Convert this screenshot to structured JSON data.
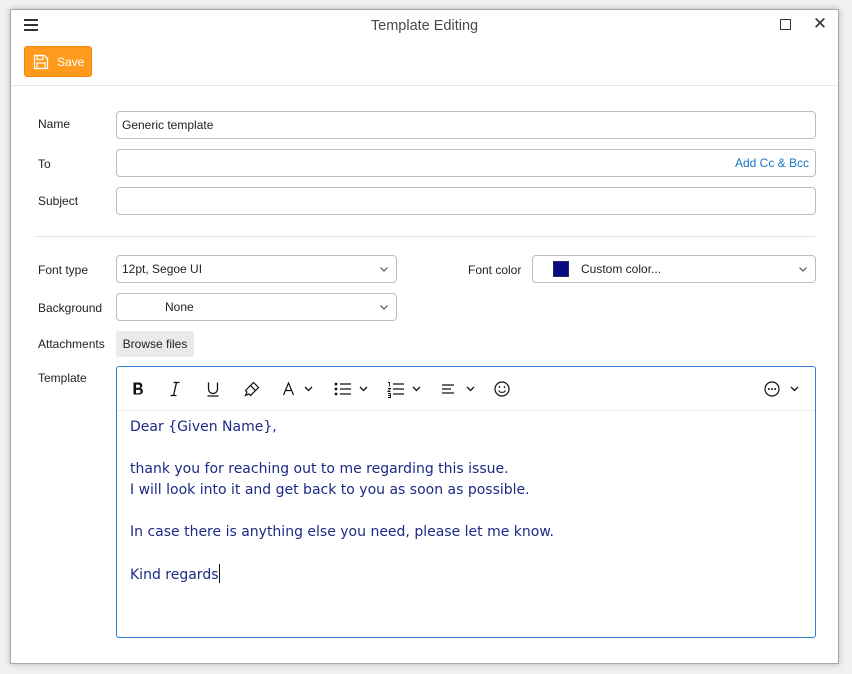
{
  "window": {
    "title": "Template Editing",
    "icons": {
      "menu": "hamburger-menu-icon",
      "maximize": "maximize-icon",
      "close": "close-icon"
    }
  },
  "toolbar": {
    "save_label": "Save",
    "save_icon": "floppy-disk-icon",
    "accent": "#ff9a1c"
  },
  "form": {
    "name_label": "Name",
    "name_value": "Generic template",
    "to_label": "To",
    "to_value": "",
    "add_cc_bcc": "Add Cc & Bcc",
    "subject_label": "Subject",
    "subject_value": "",
    "font_type_label": "Font type",
    "font_type_value": "12pt, Segoe UI",
    "font_color_label": "Font color",
    "font_color_value": "Custom color...",
    "font_color_swatch": "#0b0b80",
    "background_label": "Background",
    "background_value": "None",
    "attachments_label": "Attachments",
    "browse_label": "Browse files",
    "template_label": "Template"
  },
  "editor": {
    "toolbar_icons": [
      "bold-icon",
      "italic-icon",
      "underline-icon",
      "format-painter-icon",
      "font-color-icon",
      "bullet-list-icon",
      "numbered-list-icon",
      "align-icon",
      "emoji-icon",
      "more-options-icon"
    ],
    "lines": [
      "Dear {Given Name},",
      "",
      "thank you for reaching out to me regarding this issue.",
      "I will look into it and get back to you as soon as possible.",
      "",
      "In case there is anything else you need, please let me know.",
      "",
      "Kind regards"
    ],
    "text_color": "#1c2a86",
    "border_color": "#2f7fd0"
  }
}
